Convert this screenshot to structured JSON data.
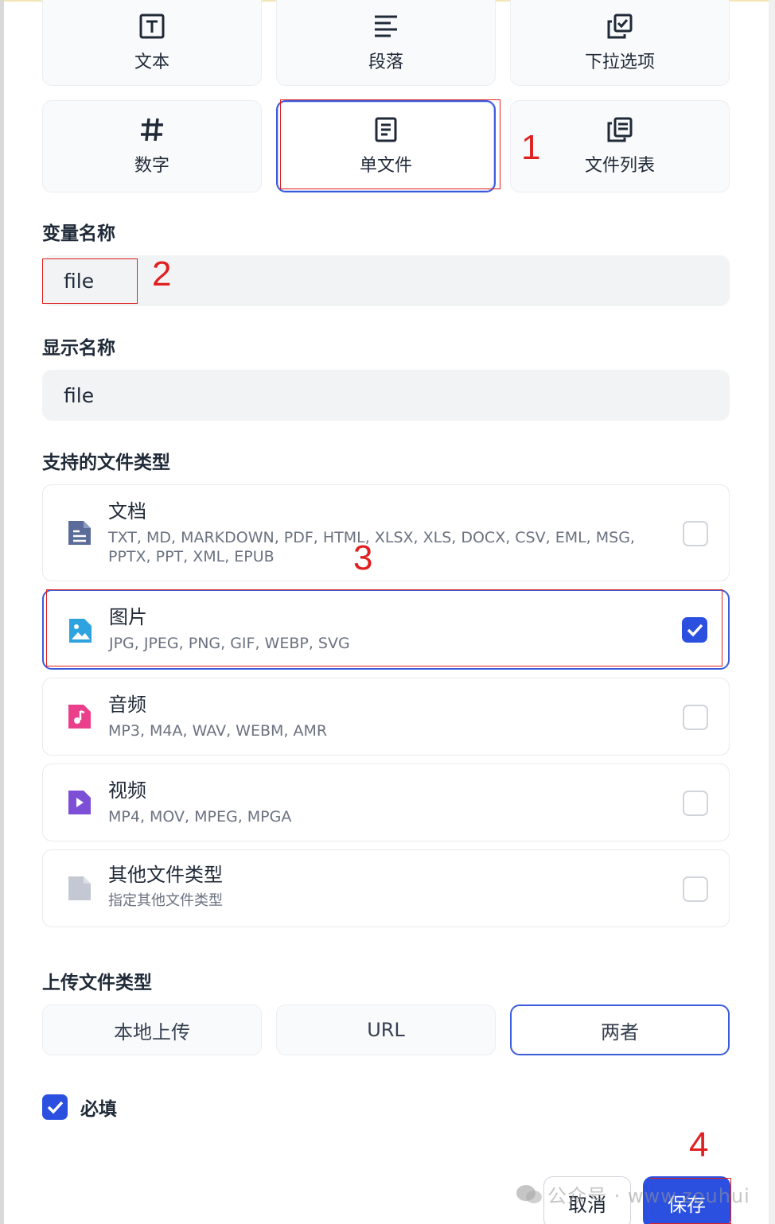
{
  "field_types": [
    {
      "label": "文本",
      "icon": "text-box-icon",
      "selected": false
    },
    {
      "label": "段落",
      "icon": "paragraph-lines-icon",
      "selected": false
    },
    {
      "label": "下拉选项",
      "icon": "select-copy-icon",
      "selected": false
    },
    {
      "label": "数字",
      "icon": "hash-icon",
      "selected": false
    },
    {
      "label": "单文件",
      "icon": "single-file-icon",
      "selected": true
    },
    {
      "label": "文件列表",
      "icon": "file-list-icon",
      "selected": false
    }
  ],
  "variable_name": {
    "label": "变量名称",
    "value": "file"
  },
  "display_name": {
    "label": "显示名称",
    "value": "file"
  },
  "file_types": {
    "label": "支持的文件类型",
    "options": [
      {
        "title": "文档",
        "desc": "TXT, MD, MARKDOWN, PDF, HTML, XLSX, XLS, DOCX, CSV, EML, MSG,",
        "desc2": "PPTX, PPT, XML, EPUB",
        "icon": "document-icon",
        "icon_color": "#5b6b9a",
        "checked": false
      },
      {
        "title": "图片",
        "desc": "JPG, JPEG, PNG, GIF, WEBP, SVG",
        "icon": "image-icon",
        "icon_color": "#2ea3e0",
        "checked": true
      },
      {
        "title": "音频",
        "desc": "MP3, M4A, WAV, WEBM, AMR",
        "icon": "audio-icon",
        "icon_color": "#ea3f8a",
        "checked": false
      },
      {
        "title": "视频",
        "desc": "MP4, MOV, MPEG, MPGA",
        "icon": "video-icon",
        "icon_color": "#7c4fd6",
        "checked": false
      },
      {
        "title": "其他文件类型",
        "desc": "指定其他文件类型",
        "icon": "other-file-icon",
        "icon_color": "#c4c8d2",
        "checked": false
      }
    ]
  },
  "upload_type": {
    "label": "上传文件类型",
    "options": [
      {
        "label": "本地上传",
        "selected": false
      },
      {
        "label": "URL",
        "selected": false
      },
      {
        "label": "两者",
        "selected": true
      }
    ]
  },
  "required": {
    "label": "必填",
    "checked": true
  },
  "actions": {
    "cancel": "取消",
    "save": "保存"
  },
  "annotations": [
    "1",
    "2",
    "3",
    "4"
  ],
  "watermark": "公众号 · www.zouhui",
  "accent_color": "#2b50e0"
}
